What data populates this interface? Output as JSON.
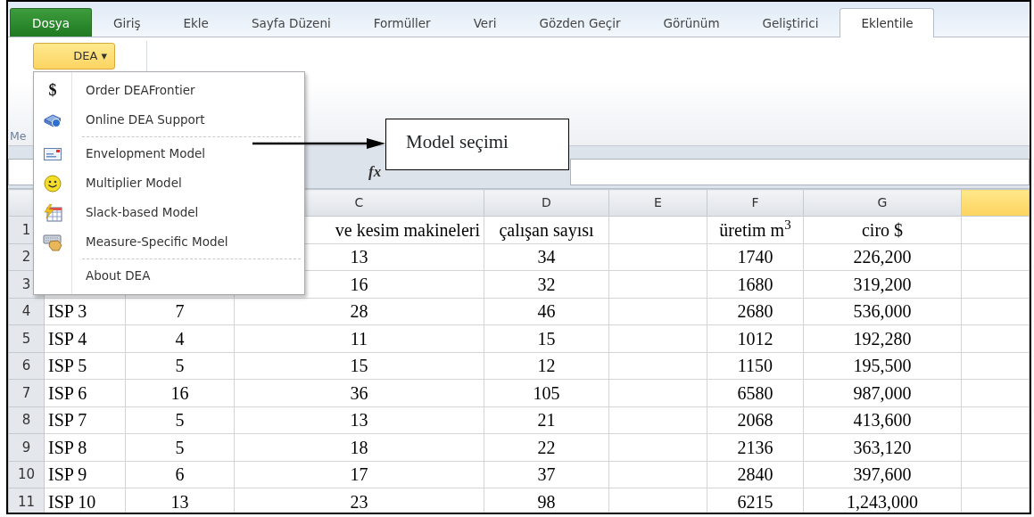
{
  "tabs": [
    {
      "label": "Dosya",
      "kind": "file",
      "selected": false
    },
    {
      "label": "Giriş",
      "kind": "tab",
      "selected": false
    },
    {
      "label": "Ekle",
      "kind": "tab",
      "selected": false
    },
    {
      "label": "Sayfa Düzeni",
      "kind": "tab",
      "selected": false
    },
    {
      "label": "Formüller",
      "kind": "tab",
      "selected": false
    },
    {
      "label": "Veri",
      "kind": "tab",
      "selected": false
    },
    {
      "label": "Gözden Geçir",
      "kind": "tab",
      "selected": false
    },
    {
      "label": "Görünüm",
      "kind": "tab",
      "selected": false
    },
    {
      "label": "Geliştirici",
      "kind": "tab",
      "selected": false
    },
    {
      "label": "Eklentile",
      "kind": "tab",
      "selected": true
    }
  ],
  "ribbon": {
    "dea_button": {
      "label": "DEA",
      "caret": "▾"
    },
    "group_label": "Me"
  },
  "dea_menu": {
    "items": [
      {
        "kind": "item",
        "glyph": "$",
        "label": "Order DEAFrontier"
      },
      {
        "kind": "item",
        "label": "Online DEA Support"
      },
      {
        "kind": "separator"
      },
      {
        "kind": "item",
        "label": "Envelopment Model"
      },
      {
        "kind": "item",
        "label": "Multiplier Model"
      },
      {
        "kind": "item",
        "label": "Slack-based Model"
      },
      {
        "kind": "item",
        "label": "Measure-Specific Model"
      },
      {
        "kind": "separator"
      },
      {
        "kind": "item",
        "label": "About DEA"
      }
    ]
  },
  "callout": {
    "text": "Model seçimi"
  },
  "formula_bar": {
    "function_label": "fx"
  },
  "sheet": {
    "columns": [
      {
        "label": "C",
        "selected": false
      },
      {
        "label": "D",
        "selected": false
      },
      {
        "label": "E",
        "selected": false
      },
      {
        "label": "F",
        "selected": false
      },
      {
        "label": "G",
        "selected": false
      },
      {
        "selected": true
      }
    ],
    "rows": [
      {
        "header": "1",
        "column_3": "ve kesim makineleri",
        "column_4": "çalışan sayısı",
        "column_6": "üretim m$^{3}$",
        "column_7": "ciro $"
      },
      {
        "header": "2",
        "column_3": "13",
        "column_4": "34",
        "column_6": "1740",
        "column_7": "226,200"
      },
      {
        "header": "3",
        "column_3": "16",
        "column_4": "32",
        "column_6": "1680",
        "column_7": "319,200"
      },
      {
        "header": "4",
        "column_1": "ISP 3",
        "column_2": "7",
        "column_3": "28",
        "column_4": "46",
        "column_6": "2680",
        "column_7": "536,000"
      },
      {
        "header": "5",
        "column_1": "ISP 4",
        "column_2": "4",
        "column_3": "11",
        "column_4": "15",
        "column_6": "1012",
        "column_7": "192,280"
      },
      {
        "header": "6",
        "column_1": "ISP 5",
        "column_2": "5",
        "column_3": "15",
        "column_4": "12",
        "column_6": "1150",
        "column_7": "195,500"
      },
      {
        "header": "7",
        "column_1": "ISP 6",
        "column_2": "16",
        "column_3": "36",
        "column_4": "105",
        "column_6": "6580",
        "column_7": "987,000"
      },
      {
        "header": "8",
        "column_1": "ISP 7",
        "column_2": "5",
        "column_3": "13",
        "column_4": "21",
        "column_6": "2068",
        "column_7": "413,600"
      },
      {
        "header": "9",
        "column_1": "ISP 8",
        "column_2": "5",
        "column_3": "18",
        "column_4": "22",
        "column_6": "2136",
        "column_7": "363,120"
      },
      {
        "header": "10",
        "column_1": "ISP 9",
        "column_2": "6",
        "column_3": "17",
        "column_4": "37",
        "column_6": "2840",
        "column_7": "397,600"
      },
      {
        "header": "11",
        "column_1": "ISP 10",
        "column_2": "13",
        "column_3": "23",
        "column_4": "98",
        "column_6": "6215",
        "column_7": "1,243,000"
      }
    ]
  }
}
